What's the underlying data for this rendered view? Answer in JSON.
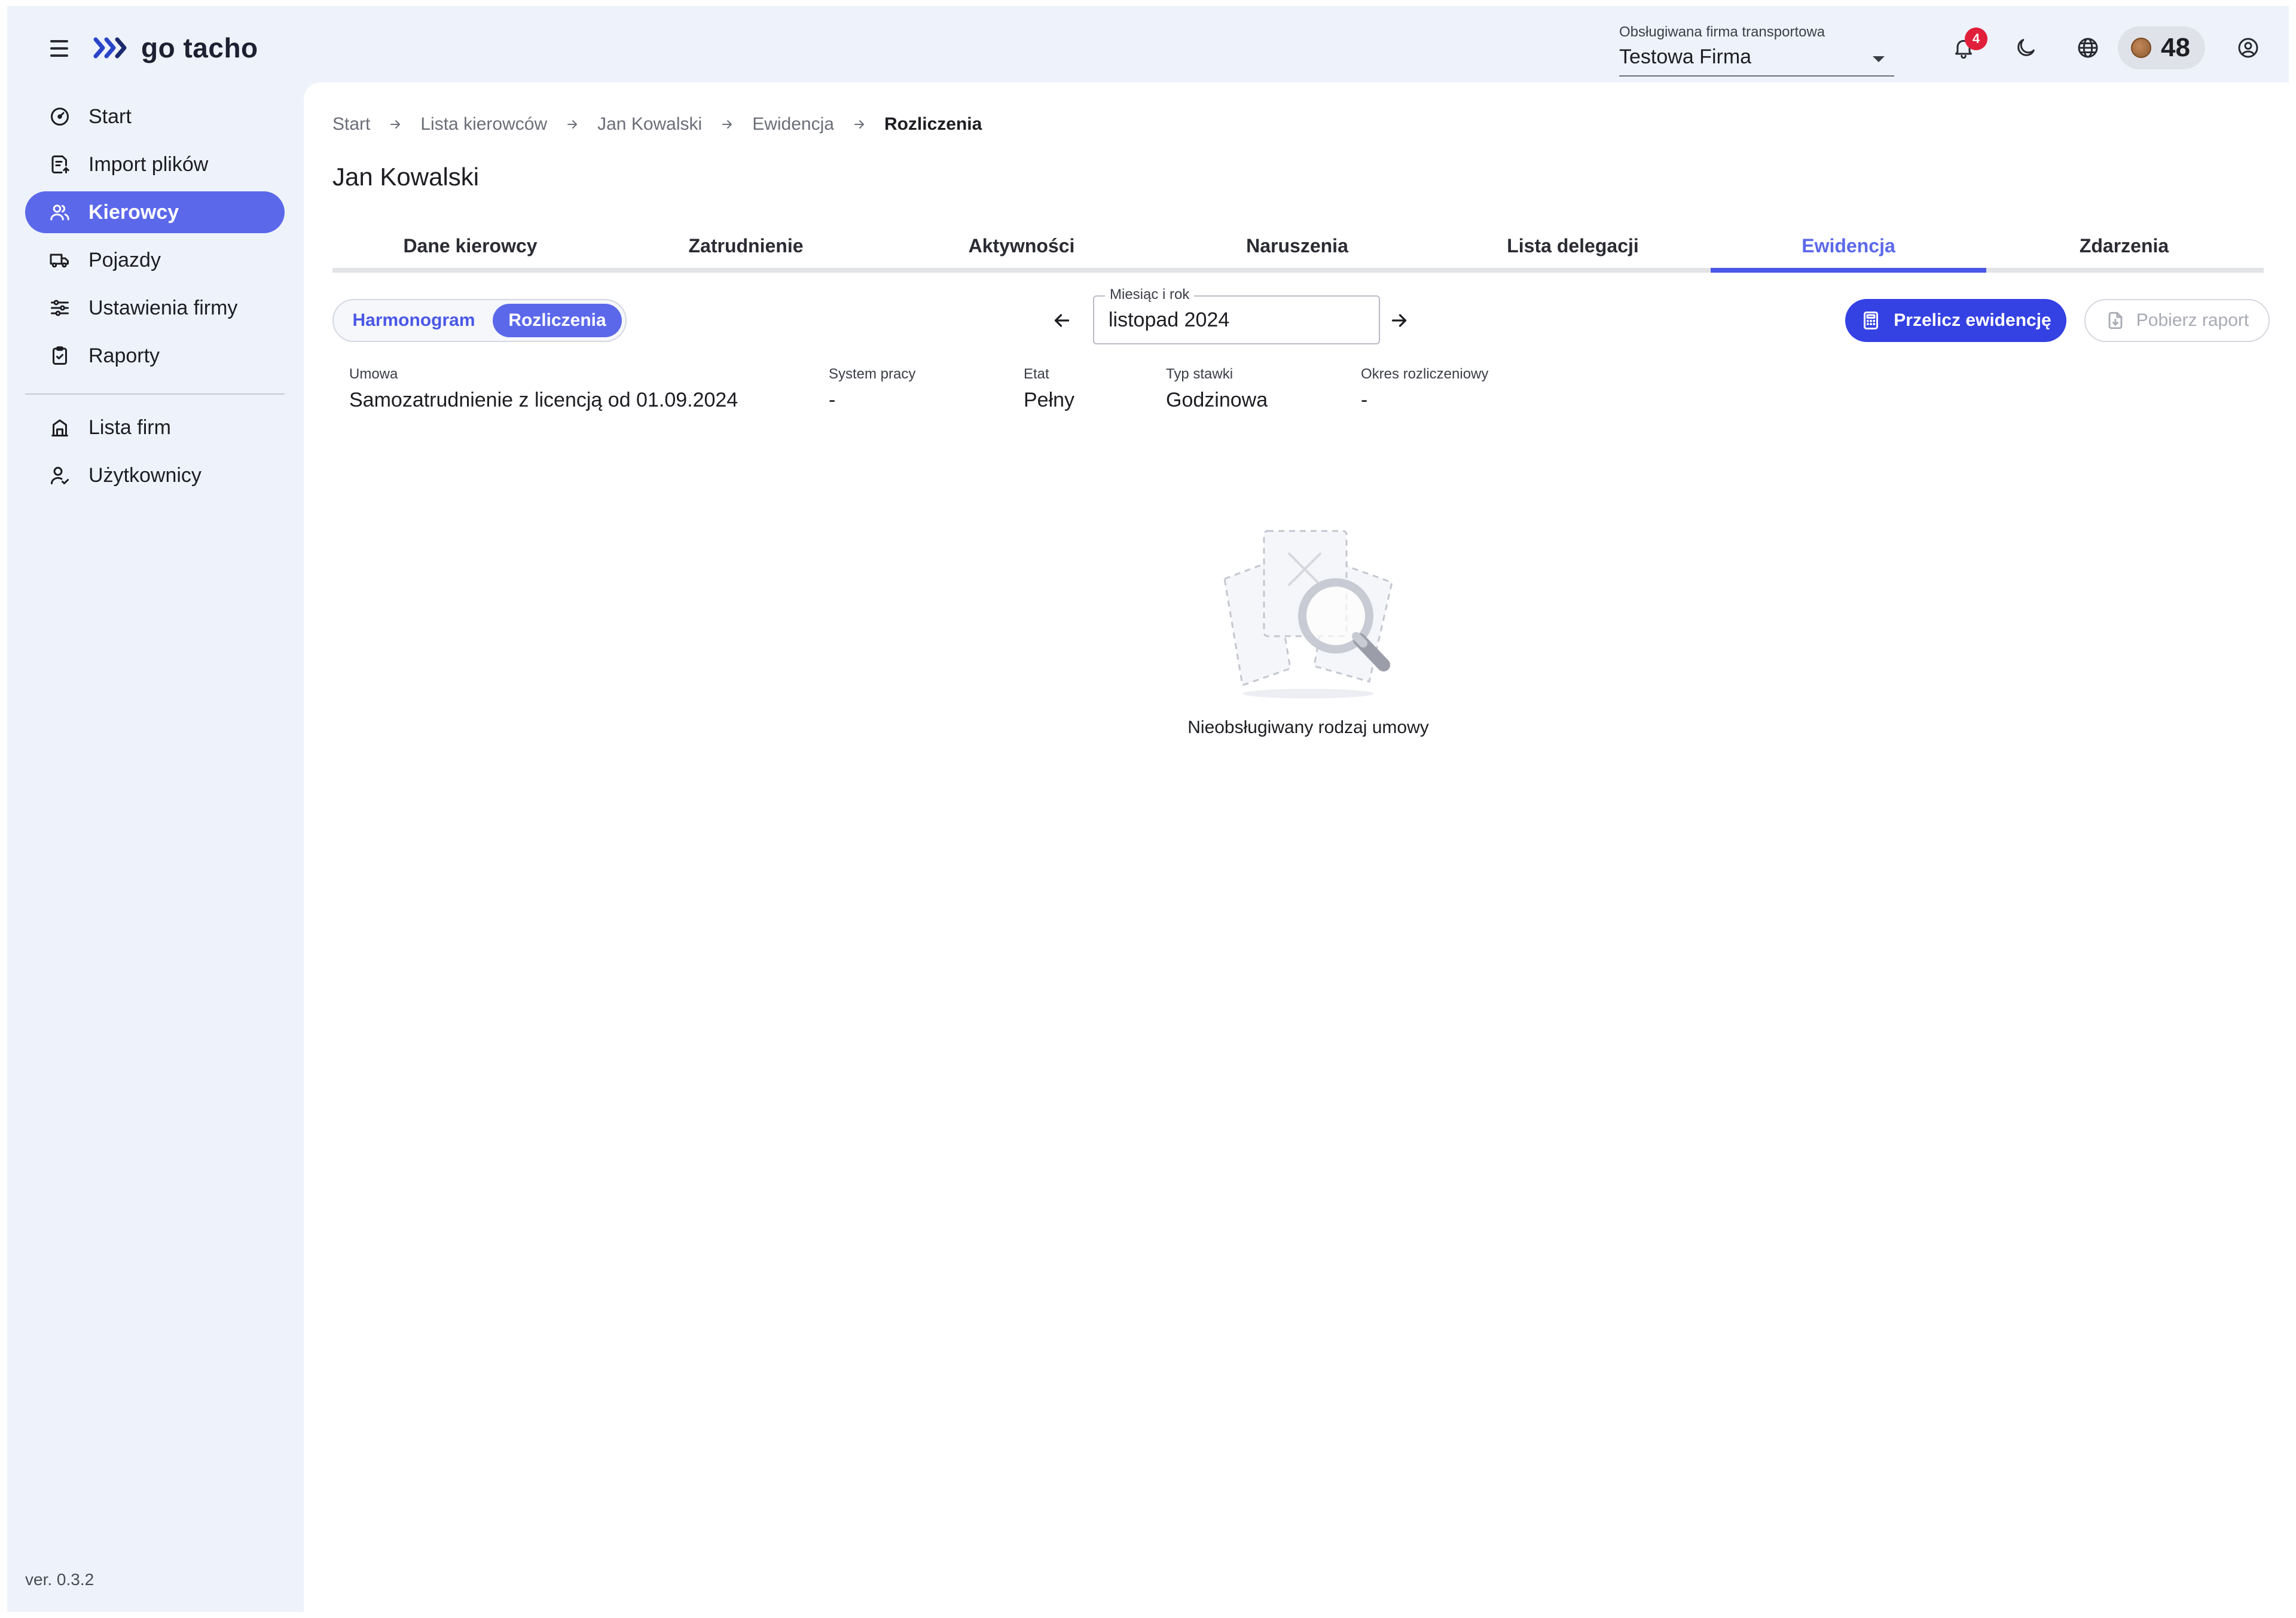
{
  "topbar": {
    "logo_text": "go tacho",
    "company_selector": {
      "label": "Obsługiwana firma transportowa",
      "value": "Testowa Firma"
    },
    "notifications_count": "4",
    "coins_value": "48"
  },
  "sidebar": {
    "items": [
      {
        "label": "Start",
        "icon": "dashboard-icon"
      },
      {
        "label": "Import plików",
        "icon": "file-import-icon"
      },
      {
        "label": "Kierowcy",
        "icon": "users-icon",
        "active": true
      },
      {
        "label": "Pojazdy",
        "icon": "truck-icon"
      },
      {
        "label": "Ustawienia firmy",
        "icon": "sliders-icon"
      },
      {
        "label": "Raporty",
        "icon": "clipboard-icon"
      }
    ],
    "secondary_items": [
      {
        "label": "Lista firm",
        "icon": "building-icon"
      },
      {
        "label": "Użytkownicy",
        "icon": "user-check-icon"
      }
    ],
    "version": "ver. 0.3.2"
  },
  "breadcrumb": [
    "Start",
    "Lista kierowców",
    "Jan Kowalski",
    "Ewidencja",
    "Rozliczenia"
  ],
  "page_title": "Jan Kowalski",
  "tabs": [
    {
      "label": "Dane kierowcy"
    },
    {
      "label": "Zatrudnienie"
    },
    {
      "label": "Aktywności"
    },
    {
      "label": "Naruszenia"
    },
    {
      "label": "Lista delegacji"
    },
    {
      "label": "Ewidencja",
      "active": true
    },
    {
      "label": "Zdarzenia"
    }
  ],
  "view_toggle": {
    "options": [
      "Harmonogram",
      "Rozliczenia"
    ],
    "selected": "Rozliczenia"
  },
  "month_picker": {
    "label": "Miesiąc i rok",
    "value": "listopad 2024"
  },
  "actions": {
    "recalculate": "Przelicz ewidencję",
    "download_report": "Pobierz raport"
  },
  "contract_info": [
    {
      "label": "Umowa",
      "value": "Samozatrudnienie z licencją od 01.09.2024"
    },
    {
      "label": "System pracy",
      "value": "-"
    },
    {
      "label": "Etat",
      "value": "Pełny"
    },
    {
      "label": "Typ stawki",
      "value": "Godzinowa"
    },
    {
      "label": "Okres rozliczeniowy",
      "value": "-"
    }
  ],
  "empty_state": {
    "message": "Nieobsługiwany rodzaj umowy"
  },
  "colors": {
    "accent": "#5b68ea",
    "primary_button": "#3441e3",
    "badge": "#e0203a",
    "app_background": "#eef3fb"
  }
}
